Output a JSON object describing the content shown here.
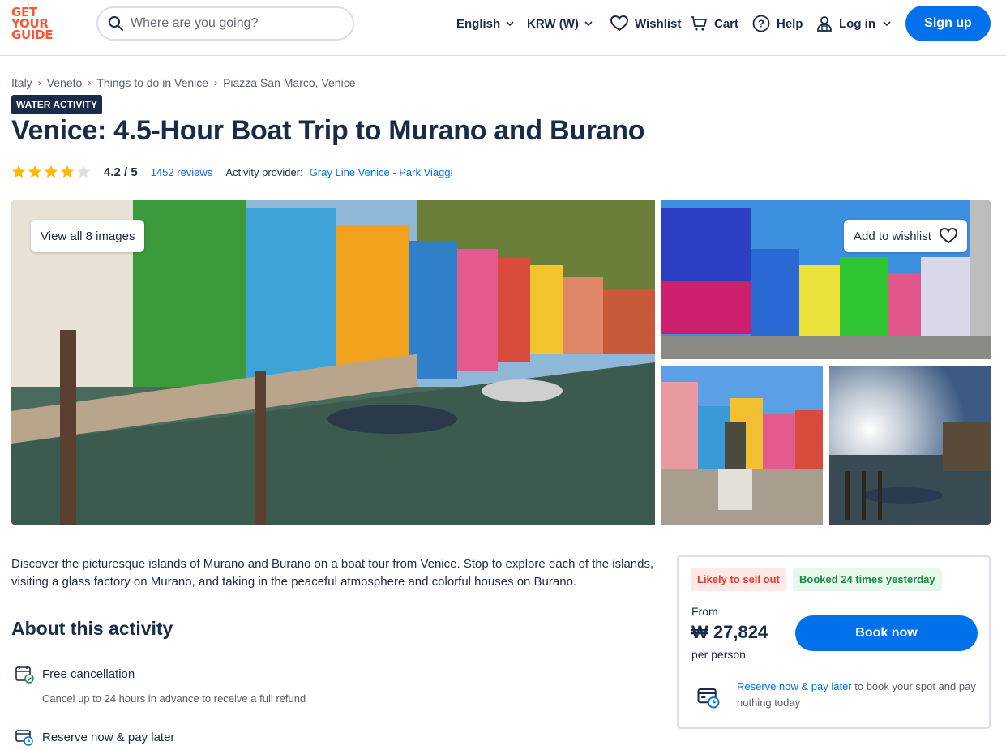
{
  "header": {
    "logo": [
      "GET",
      "YOUR",
      "GUIDE"
    ],
    "search_placeholder": "Where are you going?",
    "language": "English",
    "currency": "KRW (W)",
    "wishlist": "Wishlist",
    "cart": "Cart",
    "help": "Help",
    "login": "Log in",
    "signup": "Sign up"
  },
  "breadcrumb": [
    "Italy",
    "Veneto",
    "Things to do in Venice",
    "Piazza San Marco, Venice"
  ],
  "activity": {
    "badge": "WATER ACTIVITY",
    "title": "Venice: 4.5-Hour Boat Trip to Murano and Burano",
    "rating": "4.2 / 5",
    "rating_stars": 4.2,
    "reviews": "1452 reviews",
    "provider_label": "Activity provider:",
    "provider": "Gray Line Venice - Park Viaggi"
  },
  "gallery": {
    "view_all": "View all 8 images",
    "add_wishlist": "Add to wishlist"
  },
  "description": "Discover the picturesque islands of Murano and Burano on a boat tour from Venice. Stop to explore each of the islands, visiting a glass factory on Murano, and taking in the peaceful atmosphere and colorful houses on Burano.",
  "about": {
    "title": "About this activity",
    "features": [
      {
        "title": "Free cancellation",
        "sub": "Cancel up to 24 hours in advance to receive a full refund"
      },
      {
        "title": "Reserve now & pay later",
        "sub": ""
      }
    ]
  },
  "booking": {
    "tag_sellout": "Likely to sell out",
    "tag_booked": "Booked 24 times yesterday",
    "from": "From",
    "price": "₩ 27,824",
    "per": "per person",
    "book_button": "Book now",
    "reserve_link": "Reserve now & pay later",
    "reserve_text": " to book your spot and pay nothing today"
  },
  "colors": {
    "brand": "#ff5533",
    "primary": "#0071eb",
    "navy": "#1a2b49",
    "star": "#ffb800"
  }
}
